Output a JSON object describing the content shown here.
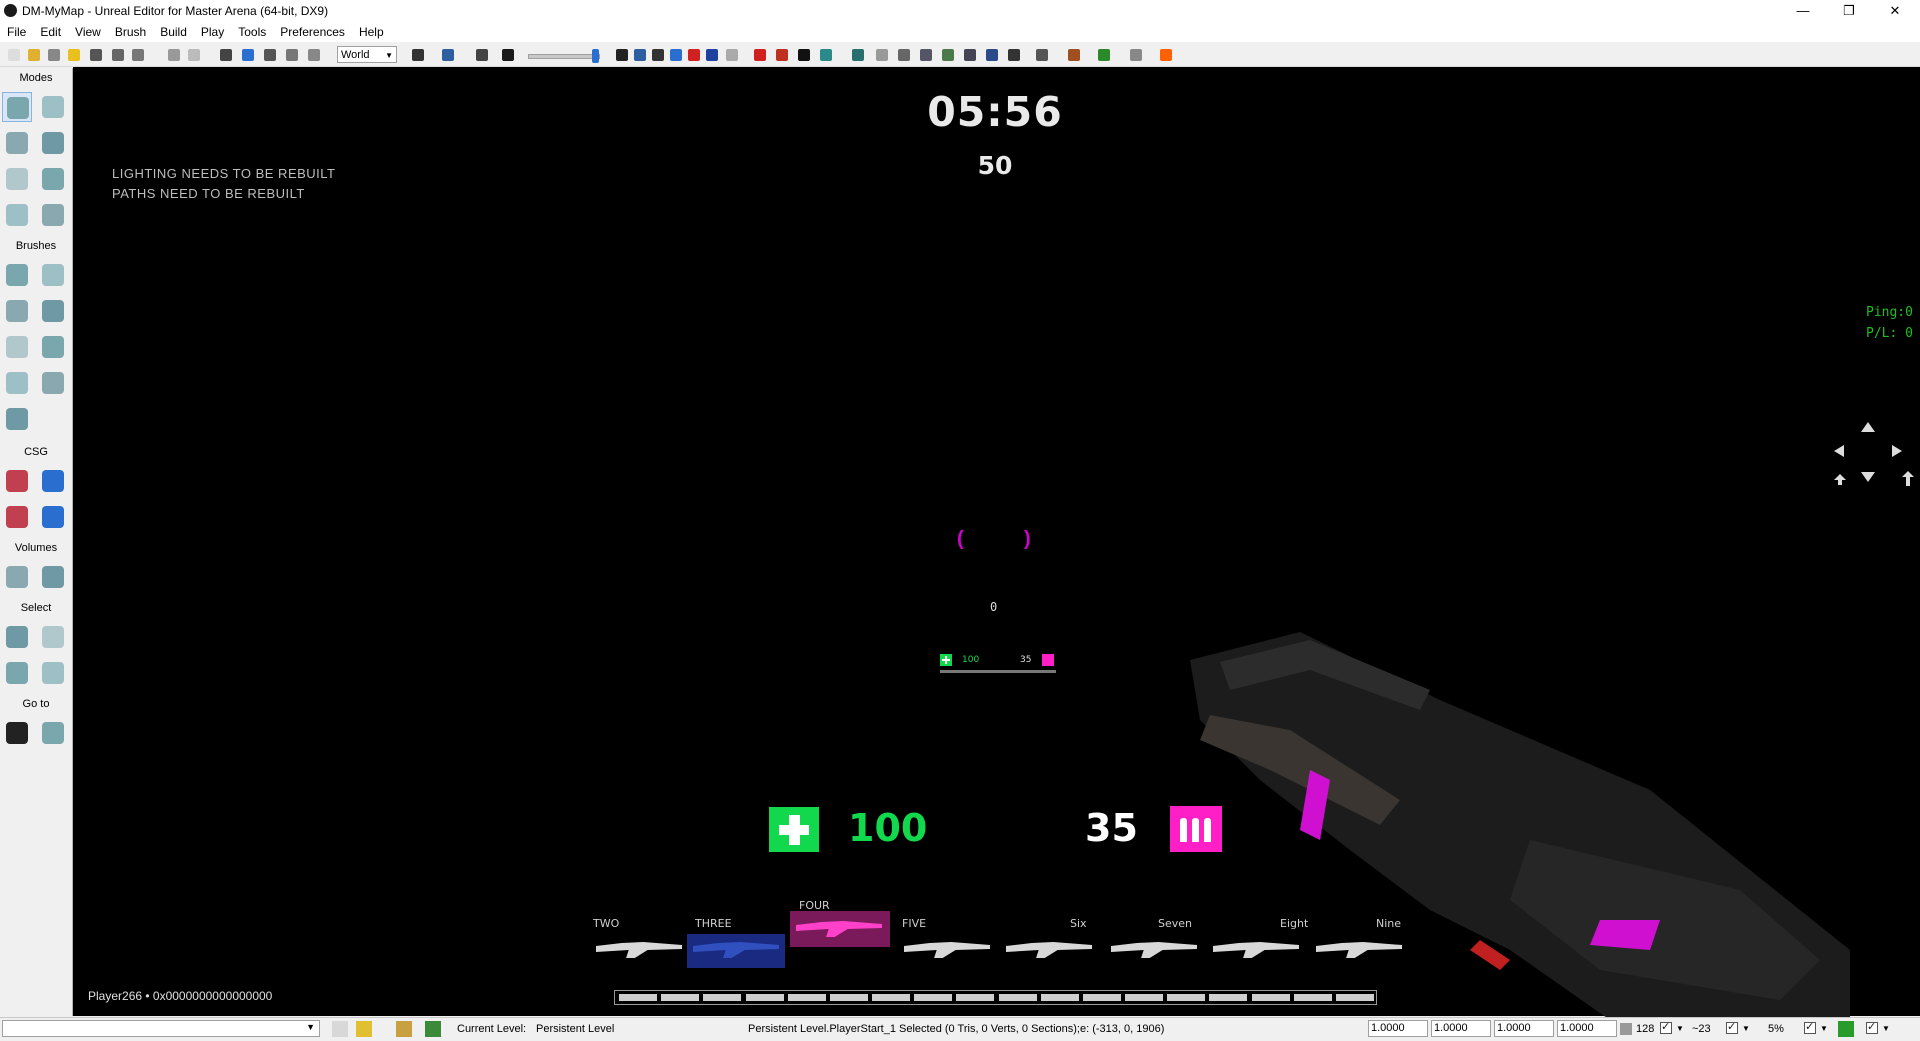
{
  "window": {
    "title": "DM-MyMap - Unreal Editor for Master Arena (64-bit, DX9)",
    "minimize": "—",
    "restore": "❐",
    "close": "✕"
  },
  "menu": [
    "File",
    "Edit",
    "View",
    "Brush",
    "Build",
    "Play",
    "Tools",
    "Preferences",
    "Help"
  ],
  "toolbar": {
    "coordinate_system": "World",
    "icons": [
      "new-icon",
      "open-icon",
      "open-dropdown-icon",
      "favorites-icon",
      "save-icon",
      "save-all-icon",
      "save-current-icon",
      "undo-icon",
      "redo-icon",
      "select-icon",
      "translate-icon",
      "rotate-icon",
      "scale-icon",
      "non-uniform-scale-icon",
      "search-icon",
      "content-browser-icon",
      "level-icon",
      "kismet-icon",
      "matinee-icon",
      "view-icon",
      "camera-icon",
      "grid-icon",
      "red-icon",
      "p-icon",
      "star-icon",
      "arrow-down-icon",
      "arrow-down-2-icon",
      "black-icon",
      "photo-icon",
      "build-icon",
      "light-icon",
      "path-icon",
      "build-paths-icon",
      "build-cover-icon",
      "build-all-icon",
      "bulb-icon",
      "lighting-icon",
      "render-icon",
      "play-in-editor-icon",
      "play-on-console-icon",
      "stop-icon",
      "mobile-icon"
    ]
  },
  "modes_panel": {
    "title": "Modes",
    "sections": [
      {
        "label": "Brushes",
        "icons": [
          "cube-brush-icon",
          "cone-brush-icon",
          "curved-stair-icon",
          "cylinder-brush-icon",
          "linear-stair-icon",
          "sheet-brush-icon",
          "spiral-stair-icon",
          "sphere-brush-icon",
          "volumetric-brush-icon"
        ]
      },
      {
        "label": "CSG",
        "icons": [
          "csg-add-icon",
          "csg-subtract-icon",
          "csg-intersect-icon",
          "csg-deintersect-icon"
        ]
      },
      {
        "label": "Volumes",
        "icons": [
          "add-volume-icon",
          "volume-shape-icon"
        ]
      },
      {
        "label": "Select",
        "icons": [
          "show-selected-icon",
          "hide-selected-icon",
          "select-inverse-icon",
          "hide-unselected-icon"
        ]
      },
      {
        "label": "Go to",
        "icons": [
          "go-to-actor-icon",
          "go-to-builder-brush-icon"
        ]
      }
    ],
    "mode_icons": [
      "camera-mode-icon",
      "geometry-mode-icon",
      "terrain-mode-icon",
      "texture-align-mode-icon",
      "mesh-paint-mode-icon",
      "static-mesh-mode-icon",
      "volume-mode-icon",
      "foliage-mode-icon"
    ]
  },
  "hud": {
    "timer": "05:56",
    "score": "50",
    "warnings": [
      "LIGHTING NEEDS TO BE REBUILT",
      "PATHS NEED TO BE REBUILT"
    ],
    "ping": "Ping:0",
    "packet_loss": "P/L: 0",
    "crosshair_left": "(",
    "crosshair_right": ")",
    "counter": "0",
    "mini_health": "100",
    "mini_ammo": "35",
    "health": "100",
    "ammo": "35",
    "weapons": [
      {
        "label": "TWO",
        "selected": false
      },
      {
        "label": "THREE",
        "selected": false
      },
      {
        "label": "FOUR",
        "selected": true
      },
      {
        "label": "FIVE",
        "selected": false
      },
      {
        "label": "Six",
        "selected": false
      },
      {
        "label": "Seven",
        "selected": false
      },
      {
        "label": "Eight",
        "selected": false
      },
      {
        "label": "Nine",
        "selected": false
      }
    ],
    "player_id": "Player266 • 0x0000000000000000",
    "colors": {
      "health": "#12d84d",
      "ammo": "#ff1fc6",
      "ping": "#1cc01c",
      "crosshair": "#d000d0"
    }
  },
  "statusbar": {
    "current_level_label": "Current Level:",
    "current_level_value": "Persistent Level",
    "selection_info": "Persistent Level.PlayerStart_1 Selected (0 Tris, 0 Verts, 0 Sections);e: (-313, 0, 1906)",
    "drag_grid": [
      "1.0000",
      "1.0000",
      "1.0000",
      "1.0000"
    ],
    "grid_size": "128",
    "rotation_snap": "~23",
    "scale_snap": "5%"
  }
}
